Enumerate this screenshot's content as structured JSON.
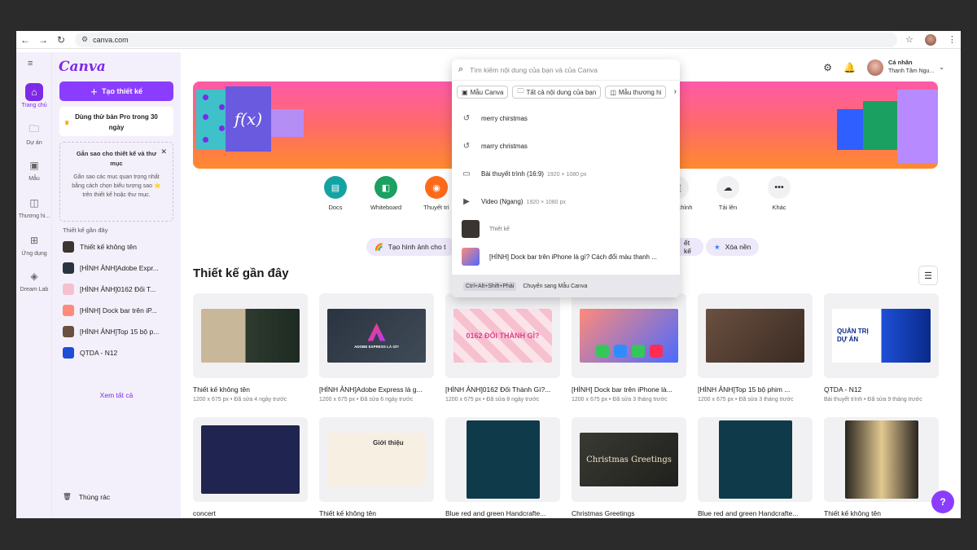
{
  "browser": {
    "url": "canva.com"
  },
  "rail": {
    "items": [
      {
        "label": "Trang chủ",
        "icon": "home-icon"
      },
      {
        "label": "Dự án",
        "icon": "folder-icon"
      },
      {
        "label": "Mẫu",
        "icon": "template-icon"
      },
      {
        "label": "Thương hi...",
        "icon": "brand-icon"
      },
      {
        "label": "Ứng dụng",
        "icon": "apps-icon"
      },
      {
        "label": "Dream Lab",
        "icon": "dreamlab-icon"
      }
    ]
  },
  "sidebar": {
    "logo": "Canva",
    "create_label": "Tạo thiết kế",
    "pro_trial": "Dùng thử bản Pro trong 30 ngày",
    "star_title": "Gắn sao cho thiết kế và thư mục",
    "star_body": "Gắn sao các mục quan trọng nhất bằng cách chọn biểu tượng sao ⭐ trên thiết kế hoặc thư mục.",
    "recent_title": "Thiết kế gần đây",
    "recent_items": [
      "Thiết kế không tên",
      "[HÌNH ẢNH]Adobe Expr...",
      "[HÌNH ẢNH]0162 Đối T...",
      "[HÌNH] Dock bar trên iP...",
      "[HÌNH ẢNH]Top 15 bộ p...",
      "QTDA - N12"
    ],
    "see_all": "Xem tất cả",
    "trash": "Thùng rác"
  },
  "topbar": {
    "user_type": "Cá nhân",
    "user_name": "Thanh Tâm Ngu..."
  },
  "banner": {
    "math_text": "f(x)"
  },
  "quick": [
    {
      "label": "Docs",
      "color": "#13a3a3"
    },
    {
      "label": "Whiteboard",
      "color": "#1aa060"
    },
    {
      "label": "Thuyết trì",
      "color": "#ff6a1a"
    },
    {
      "label": "ỡ tùy chỉnh",
      "color": "#f1f1f4"
    },
    {
      "label": "Tải lên",
      "color": "#f1f1f4"
    },
    {
      "label": "Khác",
      "color": "#f1f1f4"
    }
  ],
  "pills": {
    "magic": "Tạo hình ảnh cho t",
    "design": "ết kế",
    "remove_bg": "Xóa nền"
  },
  "recent_heading": "Thiết kế gần đây",
  "cards": [
    {
      "title": "Thiết kế không tên",
      "meta": "1200 x 675 px • Đã sửa 4 ngày trước",
      "bg": "linear-gradient(90deg,#c9b79a 0%,#c9b79a 45%,#2f3b2f 45%,#1d2a22 100%)"
    },
    {
      "title": "[HÌNH ẢNH]Adobe Express là g...",
      "meta": "1200 x 675 px • Đã sửa 6 ngày trước",
      "bg": "linear-gradient(135deg,#2a3440,#3f4b57)"
    },
    {
      "title": "[HÌNH ẢNH]0162 Đối Thành Gì?...",
      "meta": "1200 x 675 px • Đã sửa 8 ngày trước",
      "bg": "repeating-linear-gradient(45deg,#f7c0cf 0 10px,#fbe3ea 10px 20px)"
    },
    {
      "title": "[HÌNH] Dock bar trên iPhone là...",
      "meta": "1200 x 675 px • Đã sửa 3 tháng trước",
      "bg": "linear-gradient(135deg,#ff8a7a,#4a6aff)"
    },
    {
      "title": "[HÌNH ẢNH]Top 15 bộ phim ...",
      "meta": "1200 x 675 px • Đã sửa 3 tháng trước",
      "bg": "linear-gradient(135deg,#6a5040,#3a2a22)"
    },
    {
      "title": "QTDA - N12",
      "meta": "Bài thuyết trình • Đã sửa 9 tháng trước",
      "bg": "linear-gradient(90deg,#ffffff 0%,#ffffff 50%,#1d4fd6 50%,#0a2a8a 100%)"
    },
    {
      "title": "concert",
      "meta": "",
      "bg": "#1f2550"
    },
    {
      "title": "Thiết kế không tên",
      "meta": "",
      "bg": "linear-gradient(90deg,#f7efe2,#f7efe2)"
    },
    {
      "title": "Blue red and green Handcrafte...",
      "meta": "",
      "bg": "#0f3a4a"
    },
    {
      "title": "Christmas Greetings",
      "meta": "",
      "bg": "linear-gradient(135deg,#3a3a34,#20201c)"
    },
    {
      "title": "Blue red and green Handcrafte...",
      "meta": "",
      "bg": "#0f3a4a"
    },
    {
      "title": "Thiết kế không tên",
      "meta": "",
      "bg": "linear-gradient(90deg,#2a2520,#e2c890 50%,#2a2520)"
    }
  ],
  "card_texts": {
    "adobe": "ADOBE EXPRESS LÀ GÌ?",
    "doi_thanh": "0162 ĐỔI THÀNH GÌ?",
    "qtda": "QUẢN TRỊ DỰ ÁN",
    "christmas": "Christmas Greetings",
    "gioi_thieu": "Giới thiệu"
  },
  "search": {
    "placeholder": "Tìm kiếm nội dung của bạn và của Canva",
    "chips": [
      "Mẫu Canva",
      "Tất cả nội dung của bạn",
      "Mẫu thương hi"
    ],
    "suggestions": [
      {
        "text": "merry chirstmas",
        "icon": "history-icon"
      },
      {
        "text": "marry christmas",
        "icon": "history-icon"
      },
      {
        "text": "Bài thuyết trình (16:9)",
        "sub": "1920 × 1080 px",
        "icon": "presentation-icon"
      },
      {
        "text": "Video (Ngang)",
        "sub": "1920 × 1080 px",
        "icon": "video-icon"
      }
    ],
    "design_label": "Thiết kế",
    "result_text": "[HÌNH] Dock bar trên iPhone là gì? Cách đổi màu thanh ...",
    "footer_kbd": "Ctrl+Alt+Shift+Phải",
    "footer_text": "Chuyển sang Mẫu Canva"
  },
  "help": "?"
}
